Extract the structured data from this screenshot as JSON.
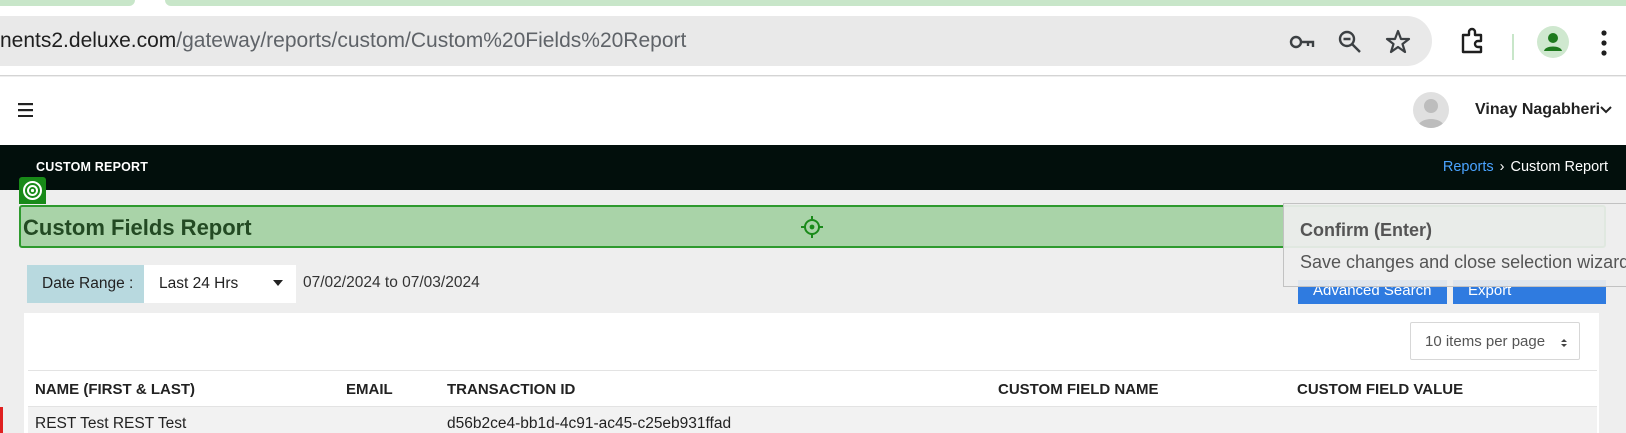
{
  "browser": {
    "url_host": "nents2.deluxe.com",
    "url_path": "/gateway/reports/custom/Custom%20Fields%20Report",
    "icons": [
      "key-icon",
      "zoom-icon",
      "star-icon",
      "extensions-icon",
      "profile-icon",
      "more-icon"
    ]
  },
  "header": {
    "menu_icon": "hamburger-icon",
    "user_name": "Vinay Nagabheri"
  },
  "titlebar": {
    "title": "CUSTOM REPORT",
    "breadcrumb": {
      "link": "Reports",
      "current": "Custom Report"
    }
  },
  "page": {
    "heading": "Custom Fields Report"
  },
  "tooltip": {
    "title": "Confirm (Enter)",
    "description": "Save changes and close selection wizard."
  },
  "filters": {
    "date_range_label": "Date Range :",
    "date_range_value": "Last 24 Hrs",
    "date_span": "07/02/2024 to 07/03/2024",
    "advanced_search_label": "Advanced Search",
    "export_label": "Export"
  },
  "table": {
    "per_page": "10 items per page",
    "columns": [
      "NAME (FIRST & LAST)",
      "EMAIL",
      "TRANSACTION ID",
      "CUSTOM FIELD NAME",
      "CUSTOM FIELD VALUE"
    ],
    "rows": [
      [
        "REST Test REST Test",
        "",
        "d56b2ce4-bb1d-4c91-ac45-c25eb931ffad",
        "",
        ""
      ]
    ]
  },
  "colors": {
    "accent_blue": "#2f7be0",
    "selection_green": "#2e9a2e",
    "titlebar_dark": "#020f0c"
  }
}
